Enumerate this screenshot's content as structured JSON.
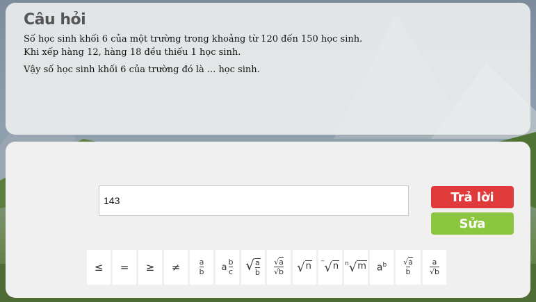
{
  "question": {
    "title": "Câu hỏi",
    "line1": "Số học sinh khối 6 của một trường trong khoảng từ 120 đến 150 học sinh.",
    "line2": "Khi xếp hàng 12, hàng 18 đều thiếu 1 học sinh.",
    "line3": "Vậy số học sinh khối 6 của trường đó là ... học sinh."
  },
  "answer": {
    "value": "143",
    "submit_label": "Trả lời",
    "edit_label": "Sửa"
  },
  "toolbar": {
    "leq": "≤",
    "eq": "=",
    "geq": "≥",
    "neq": "≠",
    "frac_a": "a",
    "frac_b": "b",
    "mixed_a": "a",
    "mixed_b": "b",
    "mixed_c": "c",
    "n": "n",
    "m": "m",
    "power_base": "a",
    "power_exp": "b"
  },
  "colors": {
    "submit": "#e13a3a",
    "edit": "#8cc63f"
  }
}
